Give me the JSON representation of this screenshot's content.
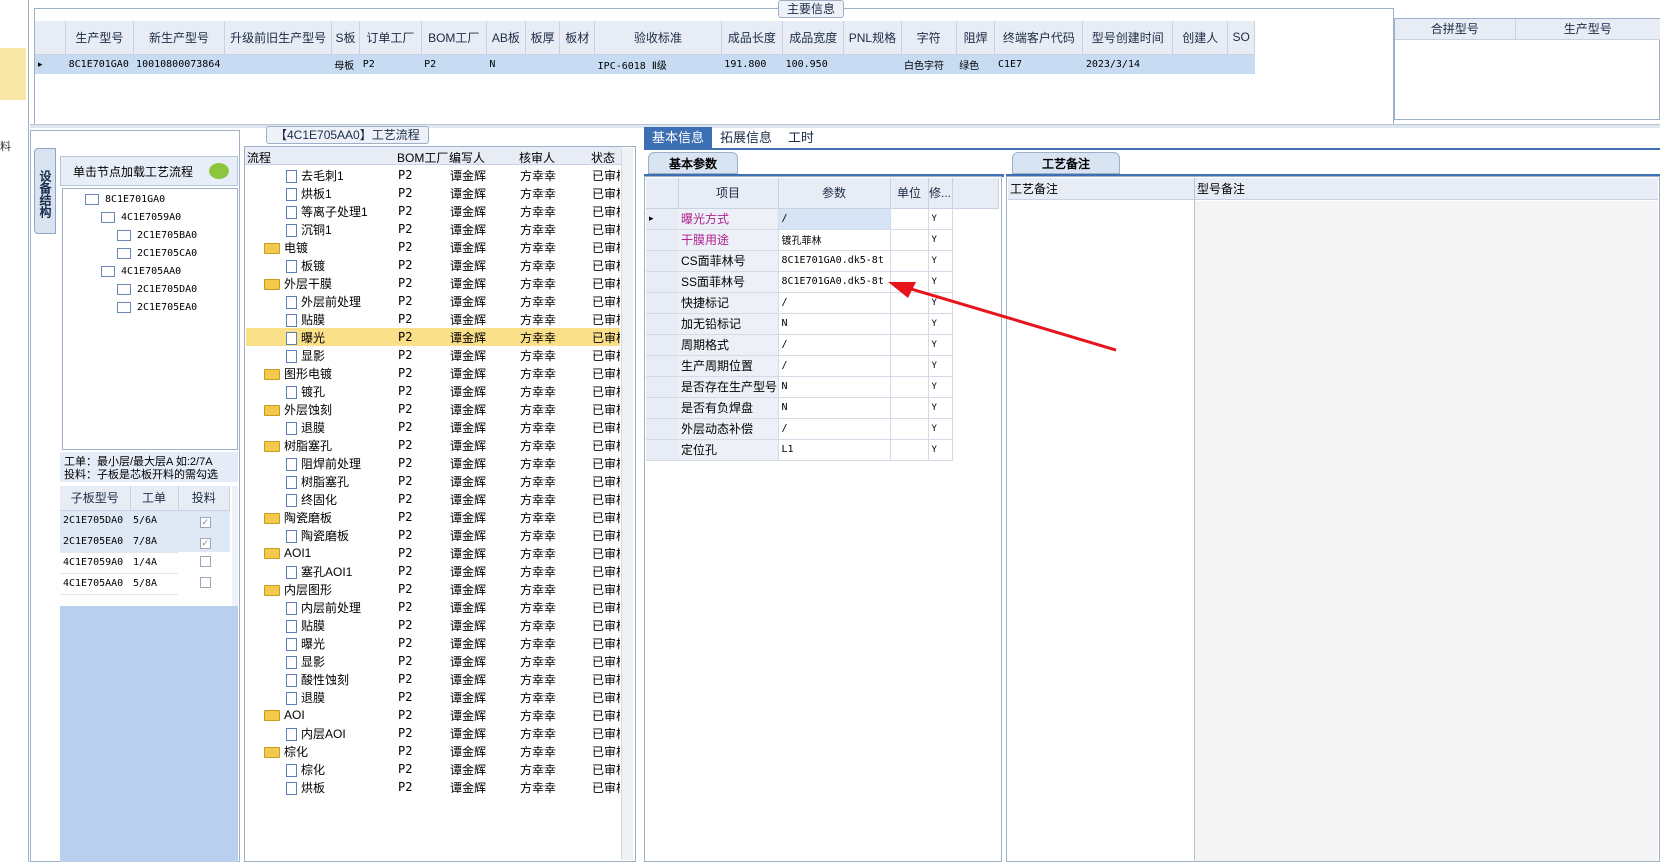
{
  "main_info": {
    "group_title": "主要信息",
    "columns": [
      "生产型号",
      "新生产型号",
      "升级前旧生产型号",
      "S板",
      "订单工厂",
      "BOM工厂",
      "AB板",
      "板厚",
      "板材",
      "验收标准",
      "成品长度",
      "成品宽度",
      "PNL规格",
      "字符",
      "阻焊",
      "终端客户代码",
      "型号创建时间",
      "创建人",
      "SO"
    ],
    "row": [
      "8C1E701GA0",
      "10010800073864",
      "",
      "母板",
      "P2",
      "P2",
      "N",
      "",
      "",
      "IPC-6018 Ⅱ级",
      "191.800",
      "100.950",
      "",
      "白色字符",
      "绿色",
      "C1E7",
      "2023/3/14",
      "",
      ""
    ],
    "side_columns": [
      "合拼型号",
      "生产型号"
    ]
  },
  "left_panel": {
    "vtab_label": "设备结构",
    "load_hint": "单击节点加载工艺流程",
    "tree": [
      {
        "label": "8C1E701GA0",
        "level": 0
      },
      {
        "label": "4C1E7059A0",
        "level": 1
      },
      {
        "label": "2C1E705BA0",
        "level": 2
      },
      {
        "label": "2C1E705CA0",
        "level": 2
      },
      {
        "label": "4C1E705AA0",
        "level": 1
      },
      {
        "label": "2C1E705DA0",
        "level": 2
      },
      {
        "label": "2C1E705EA0",
        "level": 2
      }
    ],
    "notes": [
      "工单：最小层/最大层A 如:2/7A",
      "投料：子板是芯板开料的需勾选"
    ],
    "sub_table": {
      "columns": [
        "子板型号",
        "工单",
        "投料"
      ],
      "rows": [
        [
          "2C1E705DA0",
          "5/6A",
          "checked"
        ],
        [
          "2C1E705EA0",
          "7/8A",
          "checked"
        ],
        [
          "4C1E7059A0",
          "1/4A",
          ""
        ],
        [
          "4C1E705AA0",
          "5/8A",
          ""
        ]
      ]
    }
  },
  "process": {
    "group_title": "【4C1E705AA0】工艺流程",
    "columns": [
      "流程",
      "BOM工厂",
      "编写人",
      "核审人",
      "状态"
    ],
    "rows": [
      {
        "name": "去毛刺1",
        "type": "doc",
        "level": 2,
        "bom": "P2",
        "writer": "谭金辉",
        "reviewer": "方幸幸",
        "status": "已审核"
      },
      {
        "name": "烘板1",
        "type": "doc",
        "level": 2,
        "bom": "P2",
        "writer": "谭金辉",
        "reviewer": "方幸幸",
        "status": "已审核"
      },
      {
        "name": "等离子处理1",
        "type": "doc",
        "level": 2,
        "bom": "P2",
        "writer": "谭金辉",
        "reviewer": "方幸幸",
        "status": "已审核"
      },
      {
        "name": "沉铜1",
        "type": "doc",
        "level": 2,
        "bom": "P2",
        "writer": "谭金辉",
        "reviewer": "方幸幸",
        "status": "已审核"
      },
      {
        "name": "电镀",
        "type": "folder",
        "level": 1,
        "bom": "P2",
        "writer": "谭金辉",
        "reviewer": "方幸幸",
        "status": "已审核"
      },
      {
        "name": "板镀",
        "type": "doc",
        "level": 2,
        "bom": "P2",
        "writer": "谭金辉",
        "reviewer": "方幸幸",
        "status": "已审核"
      },
      {
        "name": "外层干膜",
        "type": "folder",
        "level": 1,
        "bom": "P2",
        "writer": "谭金辉",
        "reviewer": "方幸幸",
        "status": "已审核"
      },
      {
        "name": "外层前处理",
        "type": "doc",
        "level": 2,
        "bom": "P2",
        "writer": "谭金辉",
        "reviewer": "方幸幸",
        "status": "已审核"
      },
      {
        "name": "贴膜",
        "type": "doc",
        "level": 2,
        "bom": "P2",
        "writer": "谭金辉",
        "reviewer": "方幸幸",
        "status": "已审核"
      },
      {
        "name": "曝光",
        "type": "doc",
        "level": 2,
        "bom": "P2",
        "writer": "谭金辉",
        "reviewer": "方幸幸",
        "status": "已审核",
        "selected": true
      },
      {
        "name": "显影",
        "type": "doc",
        "level": 2,
        "bom": "P2",
        "writer": "谭金辉",
        "reviewer": "方幸幸",
        "status": "已审核"
      },
      {
        "name": "图形电镀",
        "type": "folder",
        "level": 1,
        "bom": "P2",
        "writer": "谭金辉",
        "reviewer": "方幸幸",
        "status": "已审核"
      },
      {
        "name": "镀孔",
        "type": "doc",
        "level": 2,
        "bom": "P2",
        "writer": "谭金辉",
        "reviewer": "方幸幸",
        "status": "已审核"
      },
      {
        "name": "外层蚀刻",
        "type": "folder",
        "level": 1,
        "bom": "P2",
        "writer": "谭金辉",
        "reviewer": "方幸幸",
        "status": "已审核"
      },
      {
        "name": "退膜",
        "type": "doc",
        "level": 2,
        "bom": "P2",
        "writer": "谭金辉",
        "reviewer": "方幸幸",
        "status": "已审核"
      },
      {
        "name": "树脂塞孔",
        "type": "folder",
        "level": 1,
        "bom": "P2",
        "writer": "谭金辉",
        "reviewer": "方幸幸",
        "status": "已审核"
      },
      {
        "name": "阻焊前处理",
        "type": "doc",
        "level": 2,
        "bom": "P2",
        "writer": "谭金辉",
        "reviewer": "方幸幸",
        "status": "已审核"
      },
      {
        "name": "树脂塞孔",
        "type": "doc",
        "level": 2,
        "bom": "P2",
        "writer": "谭金辉",
        "reviewer": "方幸幸",
        "status": "已审核"
      },
      {
        "name": "终固化",
        "type": "doc",
        "level": 2,
        "bom": "P2",
        "writer": "谭金辉",
        "reviewer": "方幸幸",
        "status": "已审核"
      },
      {
        "name": "陶瓷磨板",
        "type": "folder",
        "level": 1,
        "bom": "P2",
        "writer": "谭金辉",
        "reviewer": "方幸幸",
        "status": "已审核"
      },
      {
        "name": "陶瓷磨板",
        "type": "doc",
        "level": 2,
        "bom": "P2",
        "writer": "谭金辉",
        "reviewer": "方幸幸",
        "status": "已审核"
      },
      {
        "name": "AOI1",
        "type": "folder",
        "level": 1,
        "bom": "P2",
        "writer": "谭金辉",
        "reviewer": "方幸幸",
        "status": "已审核"
      },
      {
        "name": "塞孔AOI1",
        "type": "doc",
        "level": 2,
        "bom": "P2",
        "writer": "谭金辉",
        "reviewer": "方幸幸",
        "status": "已审核"
      },
      {
        "name": "内层图形",
        "type": "folder",
        "level": 1,
        "bom": "P2",
        "writer": "谭金辉",
        "reviewer": "方幸幸",
        "status": "已审核"
      },
      {
        "name": "内层前处理",
        "type": "doc",
        "level": 2,
        "bom": "P2",
        "writer": "谭金辉",
        "reviewer": "方幸幸",
        "status": "已审核"
      },
      {
        "name": "贴膜",
        "type": "doc",
        "level": 2,
        "bom": "P2",
        "writer": "谭金辉",
        "reviewer": "方幸幸",
        "status": "已审核"
      },
      {
        "name": "曝光",
        "type": "doc",
        "level": 2,
        "bom": "P2",
        "writer": "谭金辉",
        "reviewer": "方幸幸",
        "status": "已审核"
      },
      {
        "name": "显影",
        "type": "doc",
        "level": 2,
        "bom": "P2",
        "writer": "谭金辉",
        "reviewer": "方幸幸",
        "status": "已审核"
      },
      {
        "name": "酸性蚀刻",
        "type": "doc",
        "level": 2,
        "bom": "P2",
        "writer": "谭金辉",
        "reviewer": "方幸幸",
        "status": "已审核"
      },
      {
        "name": "退膜",
        "type": "doc",
        "level": 2,
        "bom": "P2",
        "writer": "谭金辉",
        "reviewer": "方幸幸",
        "status": "已审核"
      },
      {
        "name": "AOI",
        "type": "folder",
        "level": 1,
        "bom": "P2",
        "writer": "谭金辉",
        "reviewer": "方幸幸",
        "status": "已审核"
      },
      {
        "name": "内层AOI",
        "type": "doc",
        "level": 2,
        "bom": "P2",
        "writer": "谭金辉",
        "reviewer": "方幸幸",
        "status": "已审核"
      },
      {
        "name": "棕化",
        "type": "folder",
        "level": 1,
        "bom": "P2",
        "writer": "谭金辉",
        "reviewer": "方幸幸",
        "status": "已审核"
      },
      {
        "name": "棕化",
        "type": "doc",
        "level": 2,
        "bom": "P2",
        "writer": "谭金辉",
        "reviewer": "方幸幸",
        "status": "已审核"
      },
      {
        "name": "烘板",
        "type": "doc",
        "level": 2,
        "bom": "P2",
        "writer": "谭金辉",
        "reviewer": "方幸幸",
        "status": "已审核"
      }
    ]
  },
  "right_tabs": [
    "基本信息",
    "拓展信息",
    "工时"
  ],
  "basic_params": {
    "title": "基本参数",
    "columns": [
      "项目",
      "参数",
      "单位",
      "修..."
    ],
    "rows": [
      {
        "item": "曝光方式",
        "value": "/",
        "unit": "",
        "mod": "Y",
        "highlight": true
      },
      {
        "item": "干膜用途",
        "value": "镀孔菲林",
        "unit": "",
        "mod": "Y",
        "highlight": true
      },
      {
        "item": "CS面菲林号",
        "value": "8C1E701GA0.dk5-8t",
        "unit": "",
        "mod": "Y"
      },
      {
        "item": "SS面菲林号",
        "value": "8C1E701GA0.dk5-8t",
        "unit": "",
        "mod": "Y"
      },
      {
        "item": "快捷标记",
        "value": "/",
        "unit": "",
        "mod": "Y"
      },
      {
        "item": "加无铅标记",
        "value": "N",
        "unit": "",
        "mod": "Y"
      },
      {
        "item": "周期格式",
        "value": "/",
        "unit": "",
        "mod": "Y"
      },
      {
        "item": "生产周期位置",
        "value": "/",
        "unit": "",
        "mod": "Y"
      },
      {
        "item": "是否存在生产型号",
        "value": "N",
        "unit": "",
        "mod": "Y"
      },
      {
        "item": "是否有负焊盘",
        "value": "N",
        "unit": "",
        "mod": "Y"
      },
      {
        "item": "外层动态补偿",
        "value": "/",
        "unit": "",
        "mod": "Y"
      },
      {
        "item": "定位孔",
        "value": "L1",
        "unit": "",
        "mod": "Y"
      }
    ]
  },
  "remarks": {
    "title": "工艺备注",
    "col1": "工艺备注",
    "col2": "型号备注"
  },
  "colors": {
    "accent": "#3d6fb5",
    "selected_row": "#c7dcf2",
    "highlight_row": "#fbe08a",
    "arrow": "#e8141b",
    "highlight_text": "#b0208e"
  }
}
